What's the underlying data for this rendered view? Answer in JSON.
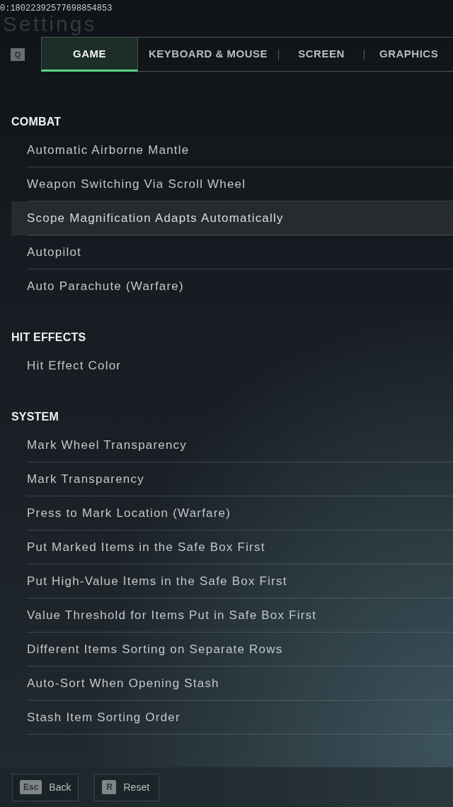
{
  "header": {
    "session_id": "0:18022392577698854853",
    "title": "Settings"
  },
  "tab_bar": {
    "prev_key": "Q",
    "tabs": [
      {
        "label": "GAME",
        "selected": true
      },
      {
        "label": "KEYBOARD & MOUSE",
        "selected": false
      },
      {
        "label": "SCREEN",
        "selected": false
      },
      {
        "label": "GRAPHICS",
        "selected": false
      }
    ]
  },
  "sections": [
    {
      "title": "COMBAT",
      "items": [
        {
          "label": "Automatic Airborne Mantle",
          "selected": false
        },
        {
          "label": "Weapon Switching Via Scroll Wheel",
          "selected": false
        },
        {
          "label": "Scope Magnification Adapts Automatically",
          "selected": true
        },
        {
          "label": "Autopilot",
          "selected": false
        },
        {
          "label": "Auto Parachute (Warfare)",
          "selected": false
        }
      ]
    },
    {
      "title": "HIT EFFECTS",
      "items": [
        {
          "label": "Hit Effect Color",
          "selected": false
        }
      ]
    },
    {
      "title": "SYSTEM",
      "items": [
        {
          "label": "Mark Wheel Transparency",
          "selected": false
        },
        {
          "label": "Mark Transparency",
          "selected": false
        },
        {
          "label": "Press to Mark Location (Warfare)",
          "selected": false
        },
        {
          "label": "Put Marked Items in the Safe Box First",
          "selected": false
        },
        {
          "label": "Put High-Value Items in the Safe Box First",
          "selected": false
        },
        {
          "label": "Value Threshold for Items Put in Safe Box First",
          "selected": false
        },
        {
          "label": "Different Items Sorting on Separate Rows",
          "selected": false
        },
        {
          "label": "Auto-Sort When Opening Stash",
          "selected": false
        },
        {
          "label": "Stash Item Sorting Order",
          "selected": false
        }
      ]
    }
  ],
  "footer": {
    "buttons": [
      {
        "key": "Esc",
        "label": "Back"
      },
      {
        "key": "R",
        "label": "Reset"
      }
    ]
  }
}
